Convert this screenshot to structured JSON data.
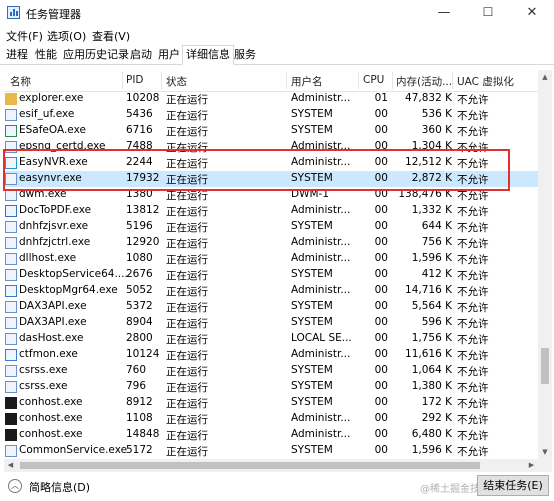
{
  "window": {
    "title": "任务管理器",
    "controls": {
      "minimize": "—",
      "maximize": "☐",
      "close": "✕"
    }
  },
  "menu": [
    "文件(F)",
    "选项(O)",
    "查看(V)"
  ],
  "tabs": [
    "进程",
    "性能",
    "应用历史记录",
    "启动",
    "用户",
    "详细信息",
    "服务"
  ],
  "active_tab": "详细信息",
  "columns": {
    "name": "名称",
    "pid": "PID",
    "status": "状态",
    "user": "用户名",
    "cpu": "CPU",
    "memory": "内存(活动...",
    "uac": "UAC 虚拟化"
  },
  "rows": [
    {
      "name": "explorer.exe",
      "pid": "10208",
      "status": "正在运行",
      "user": "Administr...",
      "cpu": "01",
      "memory": "47,832 K",
      "uac": "不允许",
      "icon": "folder-icon",
      "icon_color": "#e8b94a"
    },
    {
      "name": "esif_uf.exe",
      "pid": "5436",
      "status": "正在运行",
      "user": "SYSTEM",
      "cpu": "00",
      "memory": "536 K",
      "uac": "不允许",
      "icon": "app-window-icon",
      "icon_color": "#6b8fc7"
    },
    {
      "name": "ESafeOA.exe",
      "pid": "6716",
      "status": "正在运行",
      "user": "SYSTEM",
      "cpu": "00",
      "memory": "360 K",
      "uac": "不允许",
      "icon": "esafe-icon",
      "icon_color": "#2e8b57"
    },
    {
      "name": "epsng_certd.exe",
      "pid": "7488",
      "status": "正在运行",
      "user": "Administr...",
      "cpu": "00",
      "memory": "1,304 K",
      "uac": "不允许",
      "icon": "app-window-icon",
      "icon_color": "#6b8fc7"
    },
    {
      "name": "EasyNVR.exe",
      "pid": "2244",
      "status": "正在运行",
      "user": "Administr...",
      "cpu": "00",
      "memory": "12,512 K",
      "uac": "不允许",
      "icon": "easynvr-icon",
      "icon_color": "#1c9ad6"
    },
    {
      "name": "easynvr.exe",
      "pid": "17932",
      "status": "正在运行",
      "user": "SYSTEM",
      "cpu": "00",
      "memory": "2,872 K",
      "uac": "不允许",
      "icon": "app-window-icon",
      "icon_color": "#6b8fc7"
    },
    {
      "name": "dwm.exe",
      "pid": "1380",
      "status": "正在运行",
      "user": "DWM-1",
      "cpu": "00",
      "memory": "138,476 K",
      "uac": "不允许",
      "icon": "app-window-icon",
      "icon_color": "#6b8fc7"
    },
    {
      "name": "DocToPDF.exe",
      "pid": "13812",
      "status": "正在运行",
      "user": "Administr...",
      "cpu": "00",
      "memory": "1,332 K",
      "uac": "不允许",
      "icon": "doc-icon",
      "icon_color": "#3a6fc4"
    },
    {
      "name": "dnhfzjsvr.exe",
      "pid": "5196",
      "status": "正在运行",
      "user": "SYSTEM",
      "cpu": "00",
      "memory": "644 K",
      "uac": "不允许",
      "icon": "app-window-icon",
      "icon_color": "#6b8fc7"
    },
    {
      "name": "dnhfzjctrl.exe",
      "pid": "12920",
      "status": "正在运行",
      "user": "Administr...",
      "cpu": "00",
      "memory": "756 K",
      "uac": "不允许",
      "icon": "app-window-icon",
      "icon_color": "#6b8fc7"
    },
    {
      "name": "dllhost.exe",
      "pid": "1080",
      "status": "正在运行",
      "user": "Administr...",
      "cpu": "00",
      "memory": "1,596 K",
      "uac": "不允许",
      "icon": "app-window-icon",
      "icon_color": "#6b8fc7"
    },
    {
      "name": "DesktopService64....",
      "pid": "2676",
      "status": "正在运行",
      "user": "SYSTEM",
      "cpu": "00",
      "memory": "412 K",
      "uac": "不允许",
      "icon": "app-window-icon",
      "icon_color": "#6b8fc7"
    },
    {
      "name": "DesktopMgr64.exe",
      "pid": "5052",
      "status": "正在运行",
      "user": "Administr...",
      "cpu": "00",
      "memory": "14,716 K",
      "uac": "不允许",
      "icon": "desktop-icon",
      "icon_color": "#2f7fd0"
    },
    {
      "name": "DAX3API.exe",
      "pid": "5372",
      "status": "正在运行",
      "user": "SYSTEM",
      "cpu": "00",
      "memory": "5,564 K",
      "uac": "不允许",
      "icon": "app-window-icon",
      "icon_color": "#6b8fc7"
    },
    {
      "name": "DAX3API.exe",
      "pid": "8904",
      "status": "正在运行",
      "user": "SYSTEM",
      "cpu": "00",
      "memory": "596 K",
      "uac": "不允许",
      "icon": "app-window-icon",
      "icon_color": "#6b8fc7"
    },
    {
      "name": "dasHost.exe",
      "pid": "2800",
      "status": "正在运行",
      "user": "LOCAL SE...",
      "cpu": "00",
      "memory": "1,756 K",
      "uac": "不允许",
      "icon": "app-window-icon",
      "icon_color": "#6b8fc7"
    },
    {
      "name": "ctfmon.exe",
      "pid": "10124",
      "status": "正在运行",
      "user": "Administr...",
      "cpu": "00",
      "memory": "11,616 K",
      "uac": "不允许",
      "icon": "keyboard-icon",
      "icon_color": "#3b7dd8"
    },
    {
      "name": "csrss.exe",
      "pid": "760",
      "status": "正在运行",
      "user": "SYSTEM",
      "cpu": "00",
      "memory": "1,064 K",
      "uac": "不允许",
      "icon": "app-window-icon",
      "icon_color": "#6b8fc7"
    },
    {
      "name": "csrss.exe",
      "pid": "796",
      "status": "正在运行",
      "user": "SYSTEM",
      "cpu": "00",
      "memory": "1,380 K",
      "uac": "不允许",
      "icon": "app-window-icon",
      "icon_color": "#6b8fc7"
    },
    {
      "name": "conhost.exe",
      "pid": "8912",
      "status": "正在运行",
      "user": "SYSTEM",
      "cpu": "00",
      "memory": "172 K",
      "uac": "不允许",
      "icon": "console-icon",
      "icon_color": "#1a1a1a"
    },
    {
      "name": "conhost.exe",
      "pid": "1108",
      "status": "正在运行",
      "user": "Administr...",
      "cpu": "00",
      "memory": "292 K",
      "uac": "不允许",
      "icon": "console-icon",
      "icon_color": "#1a1a1a"
    },
    {
      "name": "conhost.exe",
      "pid": "14848",
      "status": "正在运行",
      "user": "Administr...",
      "cpu": "00",
      "memory": "6,480 K",
      "uac": "不允许",
      "icon": "console-icon",
      "icon_color": "#1a1a1a"
    },
    {
      "name": "CommonService.exe",
      "pid": "5172",
      "status": "正在运行",
      "user": "SYSTEM",
      "cpu": "00",
      "memory": "1,596 K",
      "uac": "不允许",
      "icon": "app-window-icon",
      "icon_color": "#6b8fc7"
    }
  ],
  "selected_row": 5,
  "statusbar": {
    "fewer_details": "简略信息(D)",
    "end_task": "结束任务(E)",
    "watermark": "@稀土掘金技术社区"
  }
}
